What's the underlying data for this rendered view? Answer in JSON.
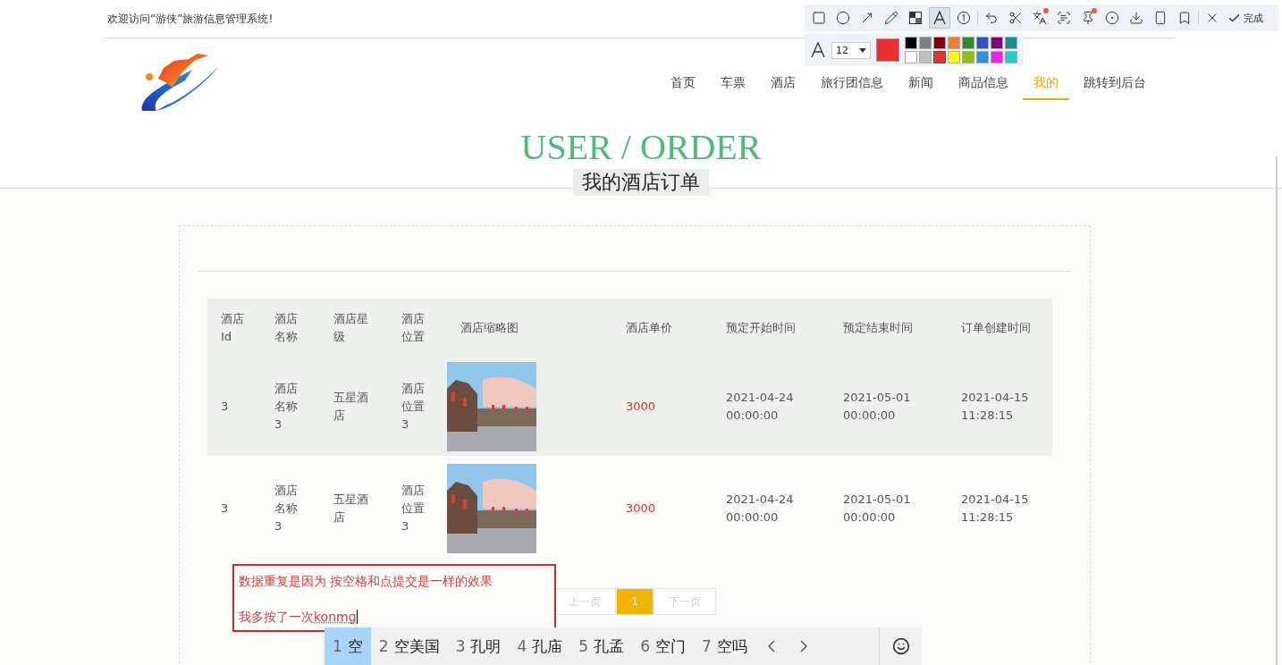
{
  "top_bar": {
    "welcome": "欢迎访问“游侠”旅游信息管理系统!"
  },
  "nav": {
    "items": [
      {
        "label": "首页",
        "selected": false
      },
      {
        "label": "车票",
        "selected": false
      },
      {
        "label": "酒店",
        "selected": false
      },
      {
        "label": "旅行团信息",
        "selected": false
      },
      {
        "label": "新闻",
        "selected": false
      },
      {
        "label": "商品信息",
        "selected": false
      },
      {
        "label": "我的",
        "selected": true
      },
      {
        "label": "跳转到后台",
        "selected": false
      }
    ]
  },
  "heading": {
    "title": "USER / ORDER",
    "subtitle": "我的酒店订单"
  },
  "table": {
    "columns": [
      "酒店Id",
      "酒店名称",
      "酒店星级",
      "酒店位置",
      "酒店缩略图",
      "酒店单价",
      "预定开始时间",
      "预定结束时间",
      "订单创建时间"
    ],
    "rows": [
      {
        "highlighted": true,
        "id": "3",
        "name": "酒店名称3",
        "star": "五星酒店",
        "location": "酒店位置3",
        "price": "3000",
        "start": "2021-04-24 00:00:00",
        "end": "2021-05-01 00:00:00",
        "created": "2021-04-15 11:28:15"
      },
      {
        "highlighted": false,
        "id": "3",
        "name": "酒店名称3",
        "star": "五星酒店",
        "location": "酒店位置3",
        "price": "3000",
        "start": "2021-04-24 00:00:00",
        "end": "2021-05-01 00:00:00",
        "created": "2021-04-15 11:28:15"
      }
    ]
  },
  "pagination": {
    "prev": "上一页",
    "pages": [
      {
        "label": "1",
        "selected": true
      }
    ],
    "next": "下一页"
  },
  "annotation": {
    "lines": [
      "数据重复是因为 按空格和点提交是一样的效果",
      "我多按了一次"
    ],
    "composing": "konmg"
  },
  "capture_toolbar": {
    "tools": [
      {
        "kind": "rect",
        "selected": false,
        "badge": false
      },
      {
        "kind": "ellipse",
        "selected": false,
        "badge": false
      },
      {
        "kind": "arrow",
        "selected": false,
        "badge": false
      },
      {
        "kind": "pencil",
        "selected": false,
        "badge": false
      },
      {
        "kind": "mosaic",
        "selected": false,
        "badge": false
      },
      {
        "kind": "text",
        "selected": true,
        "badge": false
      },
      {
        "kind": "number",
        "selected": false,
        "badge": false
      },
      {
        "kind": "undo",
        "selected": false,
        "badge": false
      },
      {
        "kind": "cut",
        "selected": false,
        "badge": false
      },
      {
        "kind": "translate",
        "selected": false,
        "badge": true
      },
      {
        "kind": "ocr",
        "selected": false,
        "badge": false
      },
      {
        "kind": "pin",
        "selected": false,
        "badge": true
      },
      {
        "kind": "record",
        "selected": false,
        "badge": false
      },
      {
        "kind": "download",
        "selected": false,
        "badge": false
      },
      {
        "kind": "phone",
        "selected": false,
        "badge": false
      },
      {
        "kind": "bookmark",
        "selected": false,
        "badge": false
      },
      {
        "kind": "close",
        "selected": false,
        "badge": false
      }
    ],
    "done": "完成",
    "font_size": "12",
    "palette": [
      {
        "color": "#000000",
        "selected": false
      },
      {
        "color": "#808080",
        "selected": false
      },
      {
        "color": "#800000",
        "selected": false
      },
      {
        "color": "#f08030",
        "selected": false
      },
      {
        "color": "#2e8b2e",
        "selected": false
      },
      {
        "color": "#3050d0",
        "selected": false
      },
      {
        "color": "#800080",
        "selected": false
      },
      {
        "color": "#109090",
        "selected": false
      },
      {
        "color": "#ffffff",
        "selected": false
      },
      {
        "color": "#c0c0c0",
        "selected": false
      },
      {
        "color": "#e83030",
        "selected": true
      },
      {
        "color": "#ffff00",
        "selected": false
      },
      {
        "color": "#90c010",
        "selected": false
      },
      {
        "color": "#3090e0",
        "selected": false
      },
      {
        "color": "#f020f0",
        "selected": false
      },
      {
        "color": "#20d0d0",
        "selected": false
      }
    ]
  },
  "ime": {
    "candidates": [
      {
        "index": "1",
        "text": "空",
        "selected": true
      },
      {
        "index": "2",
        "text": "空美国",
        "selected": false
      },
      {
        "index": "3",
        "text": "孔明",
        "selected": false
      },
      {
        "index": "4",
        "text": "孔庙",
        "selected": false
      },
      {
        "index": "5",
        "text": "孔孟",
        "selected": false
      },
      {
        "index": "6",
        "text": "空门",
        "selected": false
      },
      {
        "index": "7",
        "text": "空吗",
        "selected": false
      }
    ]
  }
}
